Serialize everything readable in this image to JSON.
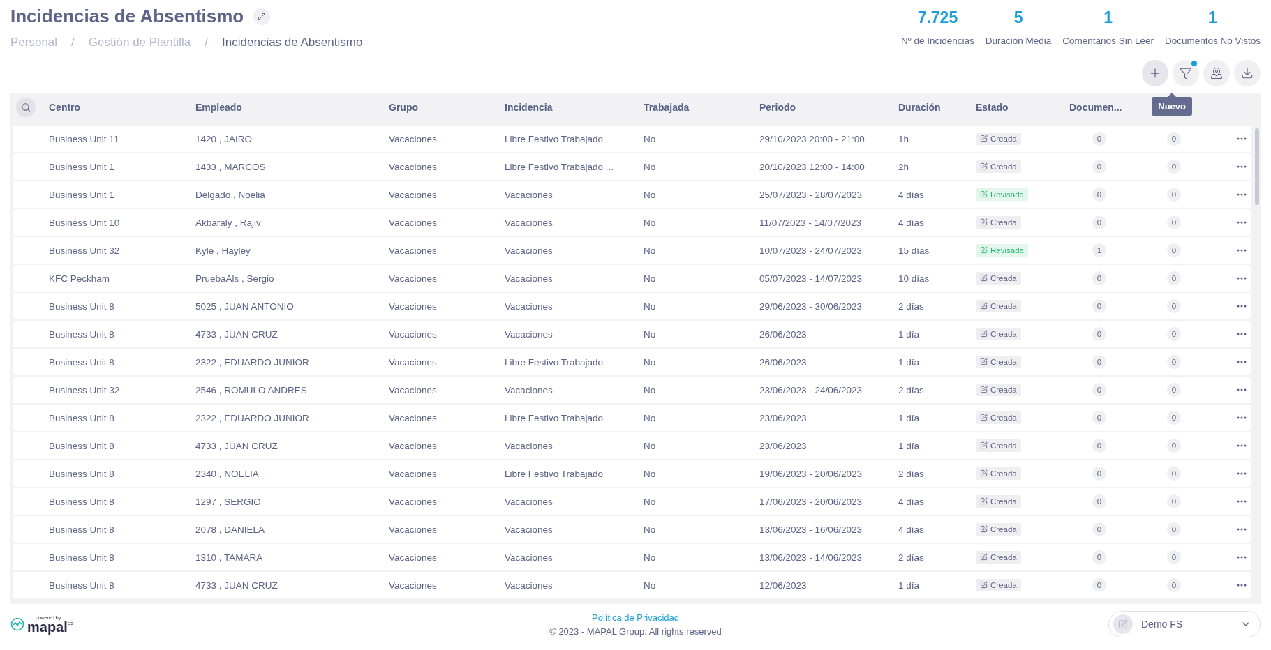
{
  "header": {
    "title": "Incidencias de Absentismo",
    "breadcrumb": [
      {
        "label": "Personal",
        "current": false
      },
      {
        "label": "Gestión de Plantilla",
        "current": false
      },
      {
        "label": "Incidencias de Absentismo",
        "current": true
      }
    ],
    "separator": "/"
  },
  "stats": [
    {
      "value": "7.725",
      "label": "Nº de Incidencias"
    },
    {
      "value": "5",
      "label": "Duración Media"
    },
    {
      "value": "1",
      "label": "Comentarios Sin Leer"
    },
    {
      "value": "1",
      "label": "Documentos No Vistos"
    }
  ],
  "toolbar": {
    "tooltip": "Nuevo",
    "filter_active": true
  },
  "table": {
    "columns": [
      "Centro",
      "Empleado",
      "Grupo",
      "Incidencia",
      "Trabajada",
      "Periodo",
      "Duración",
      "Estado",
      "Documen...",
      ""
    ],
    "rows": [
      {
        "centro": "Business Unit 11",
        "empleado": "1420 , JAIRO",
        "grupo": "Vacaciones",
        "incidencia": "Libre Festivo Trabajado",
        "trabajada": "No",
        "periodo": "29/10/2023 20:00 - 21:00",
        "duracion": "1h",
        "estado": {
          "kind": "creada",
          "label": "Creada"
        },
        "documentos": "0",
        "comentarios": "0"
      },
      {
        "centro": "Business Unit 1",
        "empleado": "1433 , MARCOS",
        "grupo": "Vacaciones",
        "incidencia": "Libre Festivo Trabajado ...",
        "trabajada": "No",
        "periodo": "20/10/2023 12:00 - 14:00",
        "duracion": "2h",
        "estado": {
          "kind": "creada",
          "label": "Creada"
        },
        "documentos": "0",
        "comentarios": "0"
      },
      {
        "centro": "Business Unit 1",
        "empleado": "Delgado , Noelia",
        "grupo": "Vacaciones",
        "incidencia": "Vacaciones",
        "trabajada": "No",
        "periodo": "25/07/2023 - 28/07/2023",
        "duracion": "4 días",
        "estado": {
          "kind": "revisada",
          "label": "Revisada"
        },
        "documentos": "0",
        "comentarios": "0"
      },
      {
        "centro": "Business Unit 10",
        "empleado": "Akbaraly , Rajiv",
        "grupo": "Vacaciones",
        "incidencia": "Vacaciones",
        "trabajada": "No",
        "periodo": "11/07/2023 - 14/07/2023",
        "duracion": "4 días",
        "estado": {
          "kind": "creada",
          "label": "Creada"
        },
        "documentos": "0",
        "comentarios": "0"
      },
      {
        "centro": "Business Unit 32",
        "empleado": "Kyle , Hayley",
        "grupo": "Vacaciones",
        "incidencia": "Vacaciones",
        "trabajada": "No",
        "periodo": "10/07/2023 - 24/07/2023",
        "duracion": "15 días",
        "estado": {
          "kind": "revisada",
          "label": "Revisada"
        },
        "documentos": "1",
        "comentarios": "0"
      },
      {
        "centro": "KFC Peckham",
        "empleado": "PruebaAls , Sergio",
        "grupo": "Vacaciones",
        "incidencia": "Vacaciones",
        "trabajada": "No",
        "periodo": "05/07/2023 - 14/07/2023",
        "duracion": "10 días",
        "estado": {
          "kind": "creada",
          "label": "Creada"
        },
        "documentos": "0",
        "comentarios": "0"
      },
      {
        "centro": "Business Unit 8",
        "empleado": "5025 , JUAN ANTONIO",
        "grupo": "Vacaciones",
        "incidencia": "Vacaciones",
        "trabajada": "No",
        "periodo": "29/06/2023 - 30/06/2023",
        "duracion": "2 días",
        "estado": {
          "kind": "creada",
          "label": "Creada"
        },
        "documentos": "0",
        "comentarios": "0"
      },
      {
        "centro": "Business Unit 8",
        "empleado": "4733 , JUAN CRUZ",
        "grupo": "Vacaciones",
        "incidencia": "Vacaciones",
        "trabajada": "No",
        "periodo": "26/06/2023",
        "duracion": "1 día",
        "estado": {
          "kind": "creada",
          "label": "Creada"
        },
        "documentos": "0",
        "comentarios": "0"
      },
      {
        "centro": "Business Unit 8",
        "empleado": "2322 , EDUARDO JUNIOR",
        "grupo": "Vacaciones",
        "incidencia": "Libre Festivo Trabajado",
        "trabajada": "No",
        "periodo": "26/06/2023",
        "duracion": "1 día",
        "estado": {
          "kind": "creada",
          "label": "Creada"
        },
        "documentos": "0",
        "comentarios": "0"
      },
      {
        "centro": "Business Unit 32",
        "empleado": "2546 , ROMULO ANDRES",
        "grupo": "Vacaciones",
        "incidencia": "Vacaciones",
        "trabajada": "No",
        "periodo": "23/06/2023 - 24/06/2023",
        "duracion": "2 días",
        "estado": {
          "kind": "creada",
          "label": "Creada"
        },
        "documentos": "0",
        "comentarios": "0"
      },
      {
        "centro": "Business Unit 8",
        "empleado": "2322 , EDUARDO JUNIOR",
        "grupo": "Vacaciones",
        "incidencia": "Libre Festivo Trabajado",
        "trabajada": "No",
        "periodo": "23/06/2023",
        "duracion": "1 día",
        "estado": {
          "kind": "creada",
          "label": "Creada"
        },
        "documentos": "0",
        "comentarios": "0"
      },
      {
        "centro": "Business Unit 8",
        "empleado": "4733 , JUAN CRUZ",
        "grupo": "Vacaciones",
        "incidencia": "Vacaciones",
        "trabajada": "No",
        "periodo": "23/06/2023",
        "duracion": "1 día",
        "estado": {
          "kind": "creada",
          "label": "Creada"
        },
        "documentos": "0",
        "comentarios": "0"
      },
      {
        "centro": "Business Unit 8",
        "empleado": "2340 , NOELIA",
        "grupo": "Vacaciones",
        "incidencia": "Libre Festivo Trabajado",
        "trabajada": "No",
        "periodo": "19/06/2023 - 20/06/2023",
        "duracion": "2 días",
        "estado": {
          "kind": "creada",
          "label": "Creada"
        },
        "documentos": "0",
        "comentarios": "0"
      },
      {
        "centro": "Business Unit 8",
        "empleado": "1297 , SERGIO",
        "grupo": "Vacaciones",
        "incidencia": "Vacaciones",
        "trabajada": "No",
        "periodo": "17/06/2023 - 20/06/2023",
        "duracion": "4 días",
        "estado": {
          "kind": "creada",
          "label": "Creada"
        },
        "documentos": "0",
        "comentarios": "0"
      },
      {
        "centro": "Business Unit 8",
        "empleado": "2078 , DANIELA",
        "grupo": "Vacaciones",
        "incidencia": "Vacaciones",
        "trabajada": "No",
        "periodo": "13/06/2023 - 16/06/2023",
        "duracion": "4 días",
        "estado": {
          "kind": "creada",
          "label": "Creada"
        },
        "documentos": "0",
        "comentarios": "0"
      },
      {
        "centro": "Business Unit 8",
        "empleado": "1310 , TAMARA",
        "grupo": "Vacaciones",
        "incidencia": "Vacaciones",
        "trabajada": "No",
        "periodo": "13/06/2023 - 14/06/2023",
        "duracion": "2 días",
        "estado": {
          "kind": "creada",
          "label": "Creada"
        },
        "documentos": "0",
        "comentarios": "0"
      },
      {
        "centro": "Business Unit 8",
        "empleado": "4733 , JUAN CRUZ",
        "grupo": "Vacaciones",
        "incidencia": "Vacaciones",
        "trabajada": "No",
        "periodo": "12/06/2023",
        "duracion": "1 día",
        "estado": {
          "kind": "creada",
          "label": "Creada"
        },
        "documentos": "0",
        "comentarios": "0"
      }
    ]
  },
  "footer": {
    "powered_by": "powered by",
    "brand": "mapal",
    "brand_suffix": "os",
    "privacy_link": "Política de Privacidad",
    "copyright": "© 2023 - MAPAL Group. All rights reserved",
    "account": "Demo FS"
  }
}
